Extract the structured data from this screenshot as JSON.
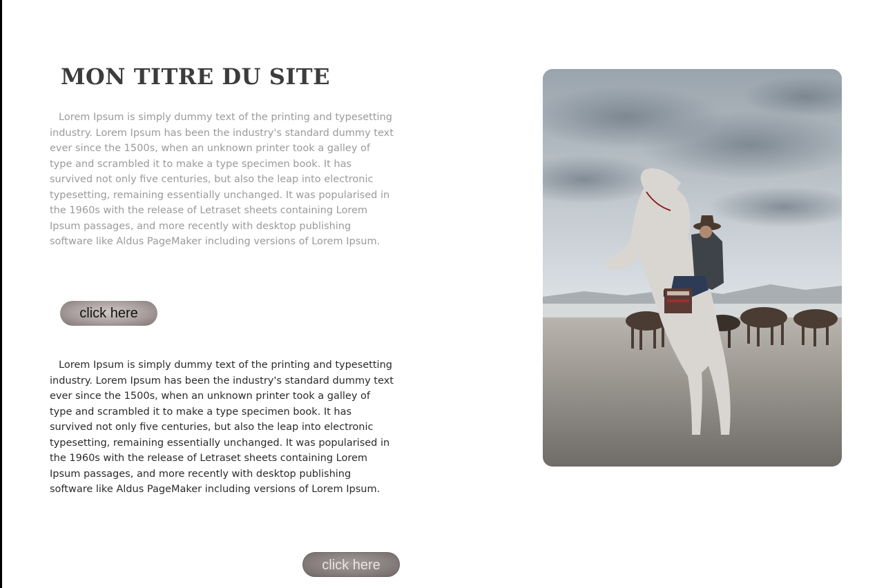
{
  "header": {
    "site_title": "Mon titre du site"
  },
  "content": {
    "paragraph_1": "Lorem Ipsum is simply dummy text of the printing and typesetting industry. Lorem Ipsum has been the industry's standard dummy text ever since the 1500s, when an unknown printer took a galley of type and scrambled it to make a type specimen book. It has survived not only five centuries, but also the leap into electronic typesetting, remaining essentially unchanged. It was popularised in the 1960s with the release of Letraset sheets containing Lorem Ipsum passages, and more recently with desktop publishing software like Aldus PageMaker including versions of Lorem Ipsum.",
    "paragraph_2": "Lorem Ipsum is simply dummy text of the printing and typesetting industry. Lorem Ipsum has been the industry's standard dummy text ever since the 1500s, when an unknown printer took a galley of type and scrambled it to make a type specimen book. It has survived not only five centuries, but also the leap into electronic typesetting, remaining essentially unchanged. It was popularised in the 1960s with the release of Letraset sheets containing Lorem Ipsum passages, and more recently with desktop publishing software like Aldus PageMaker including versions of Lorem Ipsum."
  },
  "buttons": {
    "primary_label": "click here",
    "secondary_label": "click here"
  },
  "colors": {
    "title": "#3c3c3c",
    "text_muted": "#9a9a9a",
    "text_dark": "#2a2a2a",
    "button_fill": "#a99e9e"
  }
}
